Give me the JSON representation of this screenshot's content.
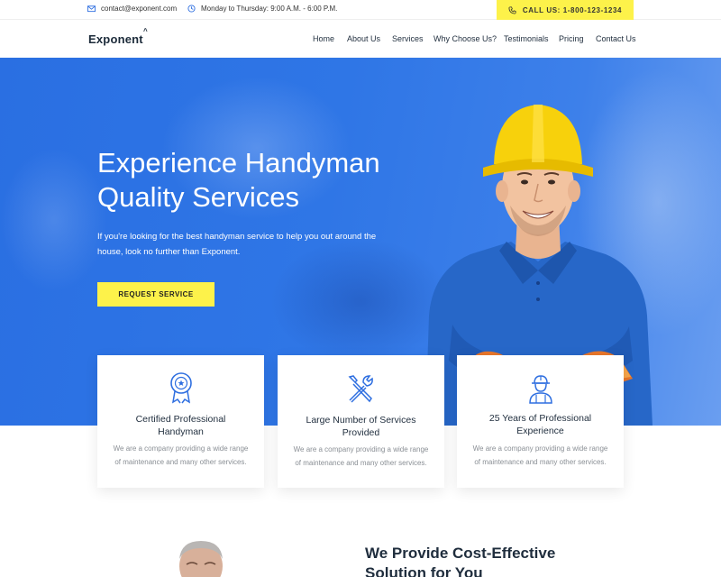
{
  "topbar": {
    "email": "contact@exponent.com",
    "hours": "Monday to Thursday: 9:00 A.M. - 6:00 P.M.",
    "call_label": "CALL US: 1-800-123-1234"
  },
  "nav": {
    "logo": "Exponent",
    "items": [
      "Home",
      "About Us",
      "Services",
      "Why Choose Us?",
      "Testimonials",
      "Pricing",
      "Contact Us"
    ]
  },
  "hero": {
    "title_line1": "Experience Handyman",
    "title_line2": "Quality Services",
    "text_line1": "If you're looking for the best handyman service to help you out around the",
    "text_line2": "house, look no further than Exponent.",
    "button": "REQUEST SERVICE"
  },
  "features": [
    {
      "icon": "award-badge-icon",
      "title_line1": "Certified Professional",
      "title_line2": "Handyman",
      "text_line1": "We are a company providing a wide range",
      "text_line2": "of maintenance and many other services."
    },
    {
      "icon": "wrench-screwdriver-icon",
      "title_line1": "Large Number of Services",
      "title_line2": "Provided",
      "text_line1": "We are a company providing a wide range",
      "text_line2": "of maintenance and many other services."
    },
    {
      "icon": "worker-helmet-icon",
      "title_line1": "25 Years of Professional",
      "title_line2": "Experience",
      "text_line1": "We are a company providing a wide range",
      "text_line2": "of maintenance and many other services."
    }
  ],
  "section2": {
    "title_line1": "We Provide Cost-Effective",
    "title_line2": "Solution for You"
  },
  "colors": {
    "accent_yellow": "#fdf24a",
    "hero_blue": "#2f76e6",
    "icon_blue": "#2f6fe0",
    "heading_dark": "#1f2d3d"
  }
}
